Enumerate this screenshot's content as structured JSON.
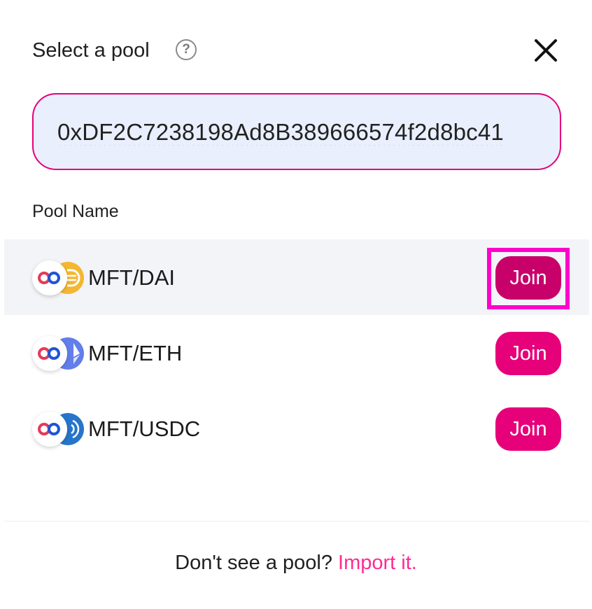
{
  "header": {
    "title": "Select a pool",
    "help_icon": "question-circle-icon",
    "close_icon": "close-x-icon"
  },
  "search": {
    "value": "0xDF2C7238198Ad8B389666574f2d8bc41",
    "placeholder": ""
  },
  "list": {
    "column_header": "Pool Name",
    "pools": [
      {
        "name": "MFT/DAI",
        "token_a_icon": "mft-logo-icon",
        "token_b_icon": "dai-logo-icon",
        "token_b_color": "#f4b731",
        "action_label": "Join",
        "highlighted": true
      },
      {
        "name": "MFT/ETH",
        "token_a_icon": "mft-logo-icon",
        "token_b_icon": "eth-logo-icon",
        "token_b_color": "#627eea",
        "action_label": "Join",
        "highlighted": false
      },
      {
        "name": "MFT/USDC",
        "token_a_icon": "mft-logo-icon",
        "token_b_icon": "usdc-logo-icon",
        "token_b_color": "#2775ca",
        "action_label": "Join",
        "highlighted": false
      }
    ]
  },
  "footer": {
    "prompt": "Don't see a pool?",
    "link_label": "Import it."
  },
  "colors": {
    "accent": "#e6007a",
    "accent_hover": "#c8006a",
    "link": "#ff2c92",
    "input_bg": "#e9effd",
    "focus_ring": "#ff00cc"
  }
}
